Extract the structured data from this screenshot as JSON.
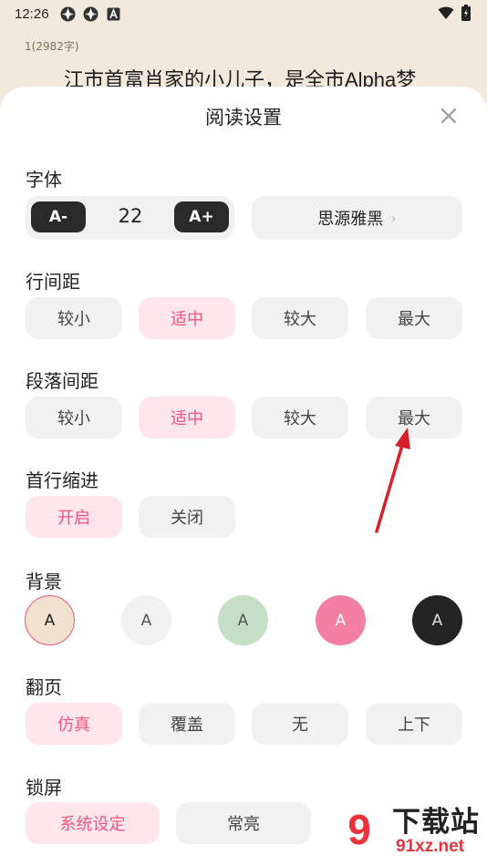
{
  "status_bar": {
    "time": "12:26"
  },
  "backdrop": {
    "chapter_count": "1(2982字)",
    "text_line": "江市首富肖家的小儿子，是全市Alpha梦"
  },
  "sheet": {
    "title": "阅读设置",
    "font": {
      "label": "字体",
      "decrease": "A-",
      "size": "22",
      "increase": "A+",
      "family": "思源雅黑",
      "family_chevron": "›"
    },
    "line_spacing": {
      "label": "行间距",
      "options": [
        "较小",
        "适中",
        "较大",
        "最大"
      ],
      "selected": "适中"
    },
    "paragraph_spacing": {
      "label": "段落间距",
      "options": [
        "较小",
        "适中",
        "较大",
        "最大"
      ],
      "selected": "适中"
    },
    "first_line_indent": {
      "label": "首行缩进",
      "options": [
        "开启",
        "关闭"
      ],
      "selected": "开启"
    },
    "background": {
      "label": "背景",
      "glyph": "A",
      "swatches": [
        "#f0e2cf",
        "#f1f1f1",
        "#c4dfc6",
        "#f47fa4",
        "#232323"
      ],
      "selected_index": 0
    },
    "page_turn": {
      "label": "翻页",
      "options": [
        "仿真",
        "覆盖",
        "无",
        "上下"
      ],
      "selected": "仿真"
    },
    "lock_screen": {
      "label": "锁屏",
      "options": [
        "系统设定",
        "常亮"
      ],
      "selected": "系统设定"
    }
  },
  "watermark": {
    "brand": "下载站",
    "url": "91xz.net"
  },
  "colors": {
    "accent": "#f0567d",
    "accent_bg": "#ffe6ec",
    "chip_bg": "#f1f1f1",
    "page_bg": "#f2e9dc"
  }
}
